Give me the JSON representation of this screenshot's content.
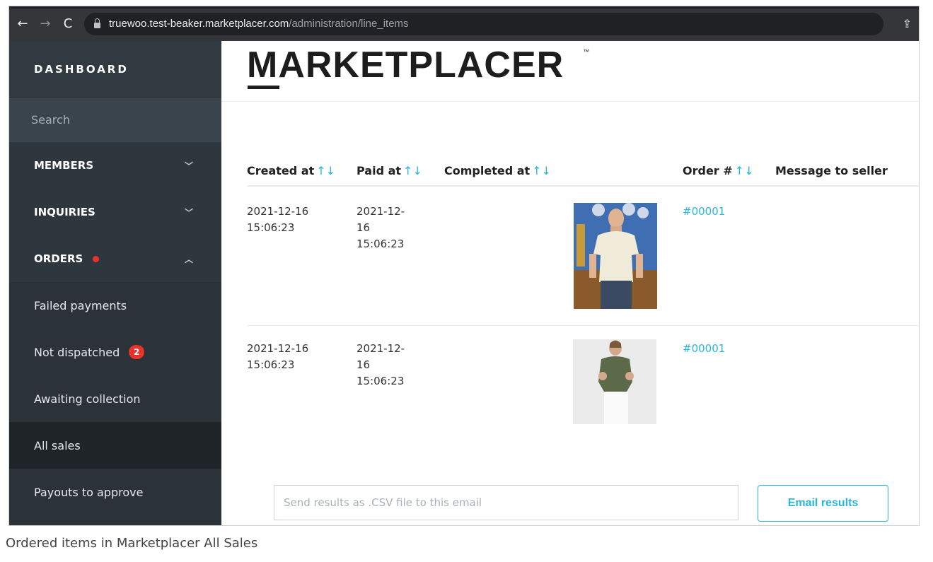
{
  "browser": {
    "url_host": "truewoo.test-beaker.marketplacer.com",
    "url_path": "/administration/line_items"
  },
  "brand": {
    "name": "MARKETPLACER",
    "tm": "™"
  },
  "sidebar": {
    "dashboard": "DASHBOARD",
    "search_placeholder": "Search",
    "sections": [
      {
        "label": "MEMBERS",
        "expanded": false
      },
      {
        "label": "INQUIRIES",
        "expanded": false
      },
      {
        "label": "ORDERS",
        "expanded": true
      }
    ],
    "orders_items": [
      {
        "label": "Failed payments"
      },
      {
        "label": "Not dispatched",
        "badge": "2"
      },
      {
        "label": "Awaiting collection"
      },
      {
        "label": "All sales",
        "active": true
      },
      {
        "label": "Payouts to approve"
      }
    ]
  },
  "table": {
    "columns": {
      "created_at": "Created at",
      "paid_at": "Paid at",
      "completed_at": "Completed at",
      "order_no": "Order #",
      "message": "Message to seller"
    },
    "sort_arrows": "↑↓",
    "rows": [
      {
        "created_at": [
          "2021-12-16",
          "15:06:23"
        ],
        "paid_at": [
          "2021-12-",
          "16",
          "15:06:23"
        ],
        "order_no": "#00001"
      },
      {
        "created_at": [
          "2021-12-16",
          "15:06:23"
        ],
        "paid_at": [
          "2021-12-",
          "16",
          "15:06:23"
        ],
        "order_no": "#00001"
      }
    ]
  },
  "export": {
    "email_placeholder": "Send results as .CSV file to this email",
    "button_label": "Email results"
  },
  "caption": "Ordered items in Marketplacer All Sales",
  "colors": {
    "accent": "#29b6d8",
    "alert": "#e8332c",
    "sidebar": "#2b3238"
  }
}
